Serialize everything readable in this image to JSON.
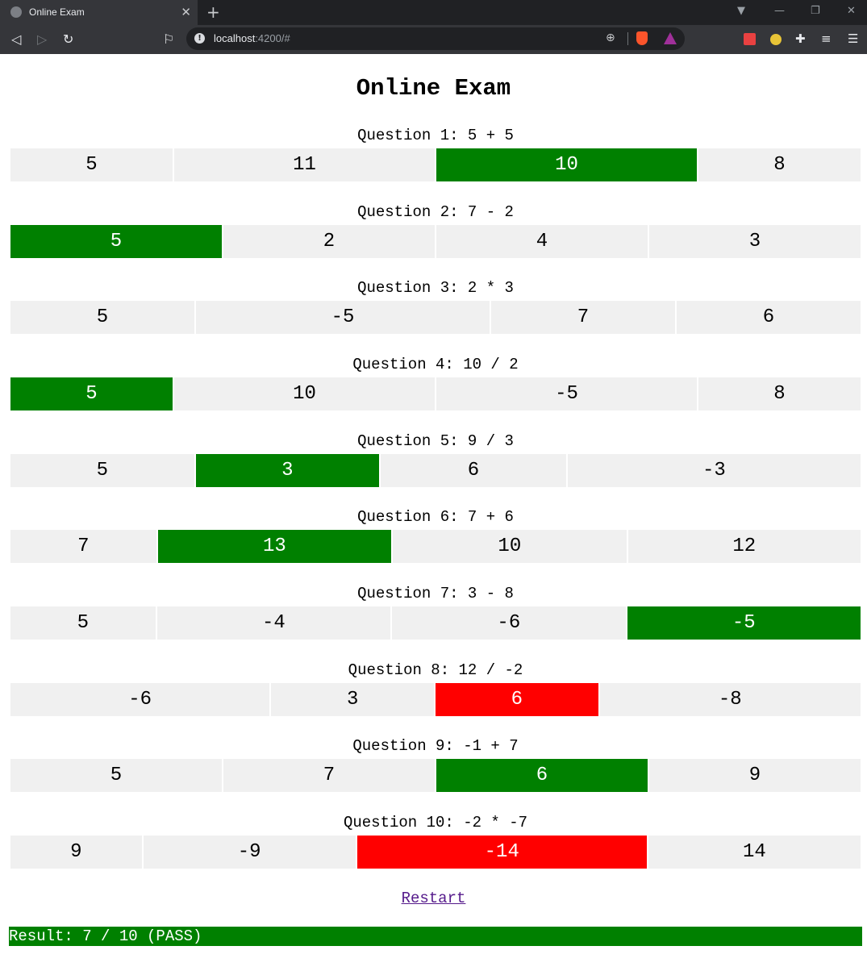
{
  "browser": {
    "tab_title": "Online Exam",
    "url_host": "localhost",
    "url_path": ":4200/#"
  },
  "page": {
    "title": "Online Exam",
    "restart_label": "Restart",
    "result_text": "Result: 7 / 10 (PASS)"
  },
  "colors": {
    "correct": "#008000",
    "wrong": "#ff0000",
    "answer_bg": "#f0f0f0"
  },
  "questions": [
    {
      "label": "Question 1: 5 + 5",
      "answers": [
        {
          "text": "5",
          "state": "none"
        },
        {
          "text": "11",
          "state": "none"
        },
        {
          "text": "10",
          "state": "correct"
        },
        {
          "text": "8",
          "state": "none"
        }
      ]
    },
    {
      "label": "Question 2: 7 - 2",
      "answers": [
        {
          "text": "5",
          "state": "correct"
        },
        {
          "text": "2",
          "state": "none"
        },
        {
          "text": "4",
          "state": "none"
        },
        {
          "text": "3",
          "state": "none"
        }
      ]
    },
    {
      "label": "Question 3: 2 * 3",
      "answers": [
        {
          "text": "5",
          "state": "none"
        },
        {
          "text": "-5",
          "state": "none"
        },
        {
          "text": "7",
          "state": "none"
        },
        {
          "text": "6",
          "state": "none"
        }
      ]
    },
    {
      "label": "Question 4: 10 / 2",
      "answers": [
        {
          "text": "5",
          "state": "correct"
        },
        {
          "text": "10",
          "state": "none"
        },
        {
          "text": "-5",
          "state": "none"
        },
        {
          "text": "8",
          "state": "none"
        }
      ]
    },
    {
      "label": "Question 5: 9 / 3",
      "answers": [
        {
          "text": "5",
          "state": "none"
        },
        {
          "text": "3",
          "state": "correct"
        },
        {
          "text": "6",
          "state": "none"
        },
        {
          "text": "-3",
          "state": "none"
        }
      ]
    },
    {
      "label": "Question 6: 7 + 6",
      "answers": [
        {
          "text": "7",
          "state": "none"
        },
        {
          "text": "13",
          "state": "correct"
        },
        {
          "text": "10",
          "state": "none"
        },
        {
          "text": "12",
          "state": "none"
        }
      ]
    },
    {
      "label": "Question 7: 3 - 8",
      "answers": [
        {
          "text": "5",
          "state": "none"
        },
        {
          "text": "-4",
          "state": "none"
        },
        {
          "text": "-6",
          "state": "none"
        },
        {
          "text": "-5",
          "state": "correct"
        }
      ]
    },
    {
      "label": "Question 8: 12 / -2",
      "answers": [
        {
          "text": "-6",
          "state": "none"
        },
        {
          "text": "3",
          "state": "none"
        },
        {
          "text": "6",
          "state": "wrong"
        },
        {
          "text": "-8",
          "state": "none"
        }
      ]
    },
    {
      "label": "Question 9: -1 + 7",
      "answers": [
        {
          "text": "5",
          "state": "none"
        },
        {
          "text": "7",
          "state": "none"
        },
        {
          "text": "6",
          "state": "correct"
        },
        {
          "text": "9",
          "state": "none"
        }
      ]
    },
    {
      "label": "Question 10: -2 * -7",
      "answers": [
        {
          "text": "9",
          "state": "none"
        },
        {
          "text": "-9",
          "state": "none"
        },
        {
          "text": "-14",
          "state": "wrong"
        },
        {
          "text": "14",
          "state": "none"
        }
      ]
    }
  ]
}
